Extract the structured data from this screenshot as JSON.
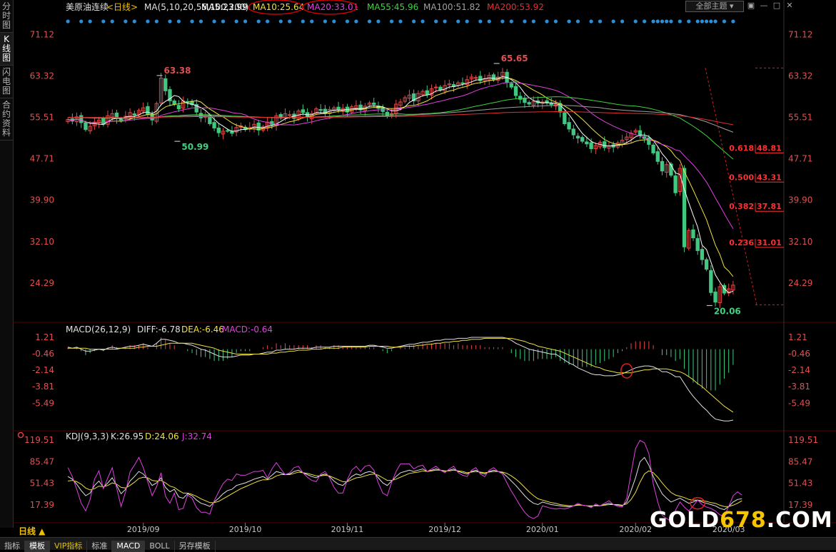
{
  "left_tabs": [
    "分时图",
    "K线图",
    "闪电图",
    "合约资料"
  ],
  "left_tab_active": 1,
  "theme_button": "全部主题",
  "theme_icons": [
    "settings-icon",
    "minimize-icon",
    "restore-icon",
    "close-icon"
  ],
  "main_legend": {
    "title": "美原油连续",
    "period": "<日线>",
    "ma_params": "MA(5,10,20,55,100,200)",
    "items": [
      {
        "text": "MA5:23.99",
        "color": "#ffffff"
      },
      {
        "text": "MA10:25.64",
        "color": "#f0e040"
      },
      {
        "text": "MA20:33.01",
        "color": "#e040e0"
      },
      {
        "text": "MA55:45.96",
        "color": "#40d040"
      },
      {
        "text": "MA100:51.82",
        "color": "#a0a0a0"
      },
      {
        "text": "MA200:53.92",
        "color": "#e03030"
      }
    ]
  },
  "macd_legend": {
    "name": "MACD(26,12,9)",
    "items": [
      {
        "text": "DIFF:-6.78",
        "color": "#e0e0e0"
      },
      {
        "text": "DEA:-6.46",
        "color": "#f0e040"
      },
      {
        "text": "MACD:-0.64",
        "color": "#e040e0"
      }
    ]
  },
  "kdj_legend": {
    "name": "KDJ(9,3,3)",
    "items": [
      {
        "text": "K:26.95",
        "color": "#e0e0e0"
      },
      {
        "text": "D:24.06",
        "color": "#f0e040"
      },
      {
        "text": "J:32.74",
        "color": "#e040e0"
      }
    ]
  },
  "bottom_tabs": [
    {
      "label": "指标",
      "active": false,
      "vip": false
    },
    {
      "label": "模板",
      "active": true,
      "vip": false
    },
    {
      "label": "VIP指标",
      "active": false,
      "vip": true
    },
    {
      "label": "标准",
      "active": false,
      "vip": false
    },
    {
      "label": "MACD",
      "active": true,
      "vip": false
    },
    {
      "label": "BOLL",
      "active": false,
      "vip": false
    },
    {
      "label": "另存模板",
      "active": false,
      "vip": false
    }
  ],
  "period_label": "日线 ▲",
  "watermark": {
    "part1": "GOLD",
    "part2": "678",
    "part3": ".COM"
  },
  "chart_data": {
    "type": "candlestick",
    "title": "美原油连续 <日线>",
    "x_ticks": [
      "2019/09",
      "2019/10",
      "2019/11",
      "2019/12",
      "2020/01",
      "2020/02",
      "2020/03"
    ],
    "price_axis": {
      "ticks": [
        71.12,
        63.32,
        55.51,
        47.71,
        39.9,
        32.1,
        24.29
      ],
      "range": [
        18.5,
        72.5
      ]
    },
    "macd_axis": {
      "ticks": [
        1.21,
        -0.46,
        -2.14,
        -3.81,
        -5.49
      ],
      "range": [
        -8.0,
        2.0
      ]
    },
    "kdj_axis": {
      "ticks": [
        119.51,
        85.47,
        51.43,
        17.39
      ],
      "range": [
        -5,
        125
      ]
    },
    "price_annotations": [
      {
        "text": "63.38",
        "kind": "high"
      },
      {
        "text": "50.99",
        "kind": "low"
      },
      {
        "text": "65.65",
        "kind": "high"
      },
      {
        "text": "20.06",
        "kind": "low"
      }
    ],
    "fibonacci": [
      {
        "ratio": "0.618",
        "price": "48.81"
      },
      {
        "ratio": "0.500",
        "price": "43.31"
      },
      {
        "ratio": "0.382",
        "price": "37.81"
      },
      {
        "ratio": "0.236",
        "price": "31.01"
      }
    ],
    "closes": [
      55.1,
      54.8,
      55.6,
      54.5,
      53.2,
      53.8,
      54.6,
      55.0,
      54.2,
      55.8,
      56.2,
      55.3,
      54.9,
      55.7,
      56.4,
      55.9,
      56.8,
      57.3,
      56.1,
      55.0,
      58.1,
      62.9,
      60.5,
      58.6,
      58.0,
      57.1,
      58.6,
      58.3,
      57.9,
      56.5,
      55.4,
      56.0,
      54.3,
      53.5,
      52.6,
      52.9,
      53.0,
      52.5,
      53.6,
      53.9,
      53.2,
      53.6,
      54.2,
      53.1,
      53.7,
      54.6,
      54.1,
      55.8,
      55.4,
      56.2,
      56.0,
      55.3,
      56.7,
      56.4,
      55.5,
      56.2,
      57.1,
      56.8,
      56.2,
      57.0,
      57.3,
      56.9,
      57.2,
      56.5,
      57.5,
      57.7,
      56.9,
      57.6,
      58.2,
      57.9,
      57.2,
      56.6,
      55.7,
      56.2,
      58.0,
      58.4,
      59.2,
      59.7,
      58.6,
      60.0,
      60.4,
      59.8,
      60.9,
      61.2,
      60.7,
      61.5,
      61.8,
      61.3,
      62.0,
      61.9,
      62.6,
      63.1,
      63.0,
      62.4,
      62.8,
      63.4,
      62.6,
      63.1,
      64.0,
      62.1,
      61.2,
      59.6,
      58.9,
      58.3,
      58.0,
      58.5,
      58.2,
      58.4,
      58.2,
      57.9,
      58.0,
      56.5,
      54.3,
      53.3,
      52.2,
      51.6,
      51.0,
      50.5,
      49.6,
      50.2,
      50.8,
      49.8,
      50.1,
      49.9,
      50.7,
      51.2,
      51.8,
      52.5,
      53.0,
      52.1,
      51.5,
      50.4,
      48.8,
      47.2,
      45.4,
      46.6,
      44.6,
      41.3,
      45.9,
      31.1,
      34.2,
      32.8,
      30.4,
      28.7,
      26.9,
      22.5,
      20.7,
      23.6,
      22.4,
      23.2,
      23.9
    ],
    "diff": [
      0.2,
      0.1,
      0.2,
      0.0,
      -0.2,
      -0.2,
      -0.1,
      0.0,
      -0.1,
      0.1,
      0.2,
      0.1,
      0.1,
      0.2,
      0.3,
      0.3,
      0.4,
      0.5,
      0.4,
      0.3,
      0.6,
      1.0,
      1.0,
      0.9,
      0.8,
      0.6,
      0.6,
      0.5,
      0.4,
      0.2,
      0.0,
      -0.1,
      -0.3,
      -0.5,
      -0.7,
      -0.8,
      -0.8,
      -0.8,
      -0.7,
      -0.6,
      -0.6,
      -0.6,
      -0.5,
      -0.5,
      -0.4,
      -0.3,
      -0.3,
      -0.1,
      -0.1,
      0.0,
      0.0,
      0.0,
      0.1,
      0.1,
      0.1,
      0.1,
      0.2,
      0.2,
      0.2,
      0.2,
      0.3,
      0.3,
      0.3,
      0.3,
      0.3,
      0.3,
      0.3,
      0.3,
      0.4,
      0.4,
      0.3,
      0.2,
      0.1,
      0.1,
      0.2,
      0.3,
      0.4,
      0.5,
      0.5,
      0.6,
      0.7,
      0.7,
      0.8,
      0.9,
      0.9,
      1.0,
      1.0,
      1.0,
      1.1,
      1.1,
      1.1,
      1.2,
      1.2,
      1.2,
      1.2,
      1.2,
      1.2,
      1.2,
      1.2,
      1.1,
      0.9,
      0.6,
      0.4,
      0.2,
      0.0,
      -0.1,
      -0.2,
      -0.3,
      -0.4,
      -0.5,
      -0.5,
      -0.8,
      -1.1,
      -1.4,
      -1.6,
      -1.9,
      -2.1,
      -2.3,
      -2.5,
      -2.6,
      -2.6,
      -2.7,
      -2.7,
      -2.7,
      -2.6,
      -2.5,
      -2.3,
      -2.1,
      -1.9,
      -1.8,
      -1.7,
      -1.7,
      -1.8,
      -2.0,
      -2.3,
      -2.3,
      -2.5,
      -2.8,
      -2.8,
      -3.5,
      -4.2,
      -4.8,
      -5.3,
      -5.8,
      -6.2,
      -6.7,
      -7.1,
      -7.2,
      -7.3,
      -7.3,
      -7.2
    ],
    "dea": [
      0.1,
      0.1,
      0.1,
      0.1,
      0.1,
      0.0,
      0.0,
      0.0,
      0.0,
      0.0,
      0.0,
      0.0,
      0.1,
      0.1,
      0.1,
      0.1,
      0.2,
      0.2,
      0.3,
      0.3,
      0.3,
      0.4,
      0.5,
      0.6,
      0.6,
      0.6,
      0.6,
      0.6,
      0.6,
      0.5,
      0.4,
      0.3,
      0.2,
      0.1,
      -0.1,
      -0.2,
      -0.3,
      -0.4,
      -0.5,
      -0.5,
      -0.5,
      -0.5,
      -0.5,
      -0.5,
      -0.5,
      -0.5,
      -0.4,
      -0.4,
      -0.3,
      -0.3,
      -0.2,
      -0.2,
      -0.1,
      -0.1,
      -0.1,
      0.0,
      0.0,
      0.0,
      0.1,
      0.1,
      0.1,
      0.1,
      0.2,
      0.2,
      0.2,
      0.2,
      0.2,
      0.2,
      0.3,
      0.3,
      0.3,
      0.3,
      0.3,
      0.2,
      0.2,
      0.2,
      0.3,
      0.3,
      0.3,
      0.4,
      0.4,
      0.5,
      0.5,
      0.6,
      0.6,
      0.7,
      0.7,
      0.8,
      0.8,
      0.9,
      0.9,
      1.0,
      1.0,
      1.0,
      1.1,
      1.1,
      1.1,
      1.1,
      1.1,
      1.1,
      1.1,
      1.0,
      0.9,
      0.8,
      0.6,
      0.5,
      0.3,
      0.2,
      0.1,
      0.0,
      -0.1,
      -0.2,
      -0.4,
      -0.6,
      -0.8,
      -1.0,
      -1.2,
      -1.4,
      -1.6,
      -1.8,
      -1.9,
      -2.1,
      -2.2,
      -2.3,
      -2.4,
      -2.4,
      -2.4,
      -2.4,
      -2.3,
      -2.2,
      -2.1,
      -2.1,
      -2.0,
      -2.0,
      -2.0,
      -2.0,
      -2.1,
      -2.2,
      -2.3,
      -2.5,
      -2.8,
      -3.1,
      -3.5,
      -3.8,
      -4.2,
      -4.6,
      -5.0,
      -5.4,
      -5.8,
      -6.1,
      -6.4
    ],
    "k": [
      62,
      58,
      50,
      40,
      32,
      36,
      48,
      55,
      45,
      52,
      60,
      48,
      35,
      42,
      55,
      62,
      70,
      66,
      58,
      48,
      52,
      60,
      45,
      38,
      42,
      30,
      28,
      35,
      32,
      25,
      20,
      18,
      15,
      22,
      28,
      35,
      40,
      42,
      48,
      50,
      52,
      55,
      58,
      60,
      62,
      58,
      64,
      70,
      68,
      65,
      66,
      70,
      72,
      68,
      65,
      62,
      60,
      64,
      66,
      62,
      55,
      50,
      48,
      55,
      62,
      66,
      64,
      68,
      70,
      68,
      60,
      52,
      48,
      55,
      62,
      68,
      70,
      72,
      70,
      72,
      74,
      70,
      72,
      74,
      72,
      70,
      72,
      74,
      70,
      68,
      66,
      70,
      72,
      68,
      66,
      70,
      72,
      70,
      68,
      62,
      55,
      48,
      40,
      32,
      25,
      20,
      18,
      22,
      20,
      18,
      17,
      16,
      15,
      15,
      16,
      18,
      17,
      16,
      15,
      17,
      16,
      18,
      20,
      18,
      17,
      16,
      22,
      40,
      60,
      85,
      92,
      80,
      62,
      48,
      35,
      28,
      22,
      25,
      28,
      24,
      20,
      22,
      25,
      22,
      20,
      18,
      16,
      12,
      10,
      15,
      22,
      26,
      27
    ],
    "d": [
      55,
      56,
      54,
      50,
      44,
      41,
      43,
      47,
      46,
      48,
      52,
      50,
      45,
      44,
      48,
      53,
      59,
      61,
      60,
      56,
      55,
      56,
      52,
      47,
      45,
      40,
      36,
      36,
      34,
      31,
      27,
      24,
      21,
      21,
      23,
      27,
      31,
      35,
      39,
      43,
      46,
      49,
      52,
      55,
      57,
      57,
      59,
      63,
      65,
      65,
      65,
      67,
      69,
      68,
      67,
      65,
      63,
      63,
      64,
      63,
      60,
      57,
      54,
      54,
      57,
      60,
      61,
      63,
      65,
      66,
      64,
      60,
      56,
      56,
      58,
      61,
      64,
      67,
      68,
      69,
      71,
      70,
      71,
      72,
      72,
      71,
      71,
      72,
      71,
      70,
      68,
      69,
      70,
      69,
      68,
      69,
      70,
      70,
      69,
      67,
      63,
      58,
      52,
      45,
      38,
      32,
      27,
      25,
      23,
      21,
      20,
      18,
      17,
      16,
      16,
      17,
      17,
      16,
      16,
      16,
      16,
      17,
      18,
      18,
      18,
      17,
      19,
      26,
      37,
      53,
      66,
      71,
      68,
      61,
      52,
      44,
      37,
      33,
      31,
      29,
      26,
      25,
      25,
      24,
      23,
      21,
      20,
      17,
      15,
      15,
      17,
      20,
      24
    ],
    "j": [
      76,
      62,
      42,
      20,
      8,
      26,
      58,
      71,
      43,
      60,
      76,
      44,
      15,
      38,
      69,
      80,
      92,
      76,
      54,
      32,
      46,
      68,
      31,
      20,
      36,
      10,
      12,
      33,
      28,
      13,
      6,
      6,
      3,
      24,
      38,
      51,
      58,
      56,
      66,
      64,
      64,
      67,
      70,
      70,
      72,
      60,
      74,
      84,
      74,
      65,
      68,
      76,
      78,
      68,
      61,
      56,
      54,
      66,
      70,
      60,
      45,
      36,
      36,
      57,
      72,
      78,
      70,
      78,
      80,
      72,
      52,
      36,
      32,
      53,
      70,
      82,
      82,
      82,
      74,
      78,
      80,
      70,
      74,
      78,
      72,
      68,
      74,
      78,
      68,
      64,
      62,
      72,
      76,
      66,
      62,
      72,
      76,
      70,
      66,
      52,
      39,
      28,
      16,
      6,
      -1,
      -4,
      0,
      16,
      14,
      12,
      11,
      12,
      11,
      13,
      16,
      20,
      17,
      16,
      13,
      19,
      16,
      20,
      24,
      18,
      15,
      14,
      28,
      68,
      106,
      119,
      115,
      98,
      50,
      22,
      1,
      -4,
      -8,
      9,
      22,
      14,
      8,
      16,
      25,
      18,
      14,
      12,
      8,
      2,
      0,
      15,
      32,
      38,
      33
    ]
  }
}
